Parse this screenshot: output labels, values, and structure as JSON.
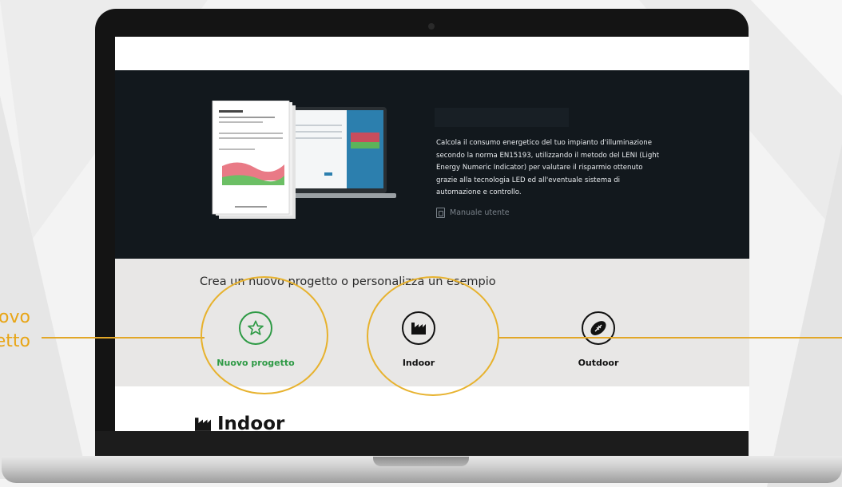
{
  "callout": {
    "side_text_line1": "Nuovo",
    "side_text_line2": "progetto"
  },
  "hero": {
    "description": "Calcola il consumo energetico del tuo impianto d'illuminazione secondo la norma EN15193, utilizzando il metodo del LENI (Light Energy Numeric Indicator) per valutare il risparmio ottenuto grazie alla tecnologia LED ed all'eventuale sistema di automazione e controllo.",
    "manual_link": "Manuale utente"
  },
  "create": {
    "heading": "Crea un nuovo progetto o personalizza un esempio",
    "options": [
      {
        "label": "Nuovo progetto",
        "icon": "star-icon"
      },
      {
        "label": "Indoor",
        "icon": "factory-icon"
      },
      {
        "label": "Outdoor",
        "icon": "football-icon"
      }
    ]
  },
  "section": {
    "title": "Indoor",
    "icon": "factory-icon"
  },
  "colors": {
    "accent_green": "#2e9a45",
    "callout_yellow": "#e7b22e",
    "hero_bg": "#12181d"
  }
}
